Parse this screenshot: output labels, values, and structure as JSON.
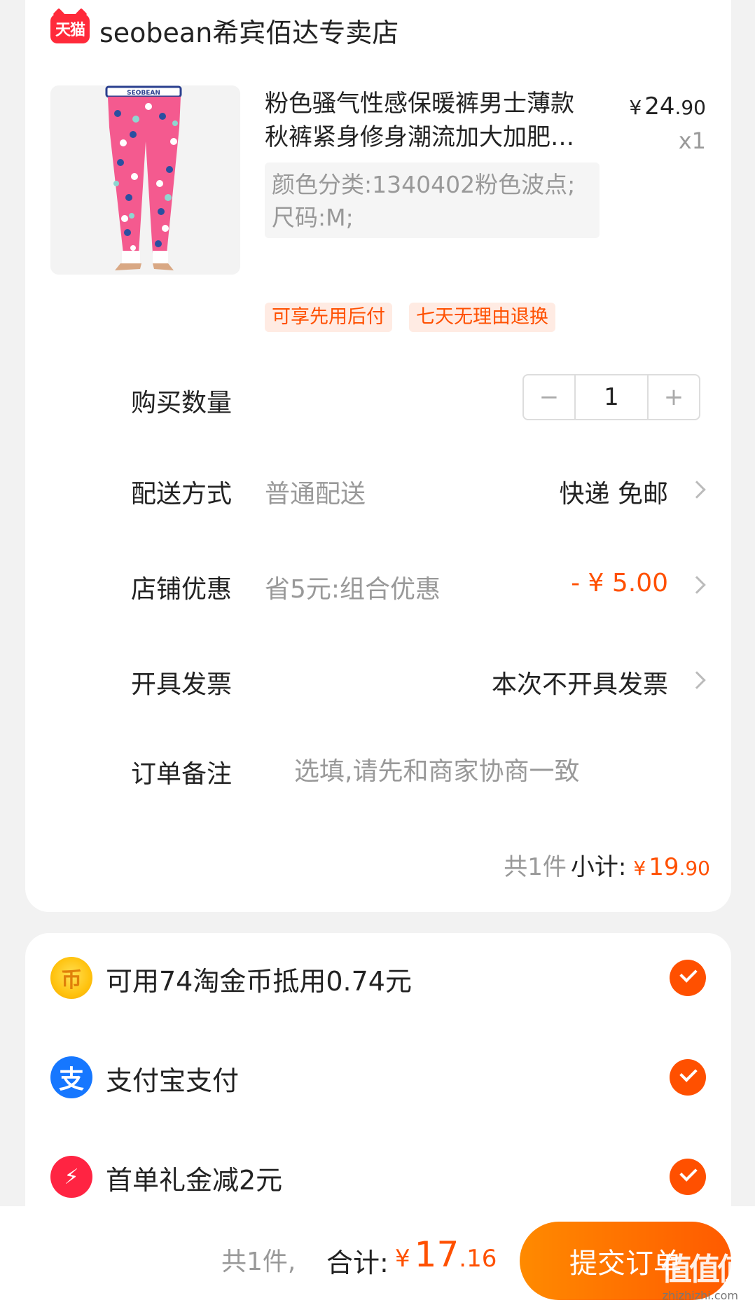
{
  "store": {
    "badge": "天猫",
    "name": "seobean希宾佰达专卖店"
  },
  "product": {
    "title": "粉色骚气性感保暖裤男士薄款秋裤紧身修身潮流加大加肥男士秋裤",
    "price_symbol": "¥",
    "price_int": "24",
    "price_dec": ".90",
    "quantity_label": "x1",
    "sku": "颜色分类:1340402粉色波点;尺码:M;",
    "tags": [
      "可享先用后付",
      "七天无理由退换"
    ],
    "image_brand": "SEOBEAN"
  },
  "rows": {
    "quantity": {
      "label": "购买数量",
      "value": "1",
      "minus": "−",
      "plus": "+"
    },
    "delivery": {
      "label": "配送方式",
      "sub": "普通配送",
      "value": "快递 免邮"
    },
    "discount": {
      "label": "店铺优惠",
      "sub": "省5元:组合优惠",
      "value": "- ¥ 5.00"
    },
    "invoice": {
      "label": "开具发票",
      "value": "本次不开具发票"
    },
    "remark": {
      "label": "订单备注",
      "placeholder": "选填,请先和商家协商一致"
    }
  },
  "subtotal": {
    "count": "共1件",
    "label": "小计:",
    "symbol": "¥",
    "int": "19",
    "dec": ".90"
  },
  "payment": {
    "coins": "可用74淘金币抵用0.74元",
    "coin_glyph": "币",
    "alipay": "支付宝支付",
    "alipay_glyph": "支",
    "first_order": "首单礼金减2元",
    "bolt_glyph": "⚡"
  },
  "bottom": {
    "count": "共1件,",
    "total_label": "合计:",
    "symbol": "¥",
    "int": "17",
    "dec": ".16",
    "submit": "提交订单",
    "watermark": "值值值",
    "watermark_url": "zhizhizhi.com"
  },
  "colors": {
    "accent": "#ff5000",
    "tmall_red": "#ff2a3a",
    "alipay_blue": "#1677ff"
  }
}
